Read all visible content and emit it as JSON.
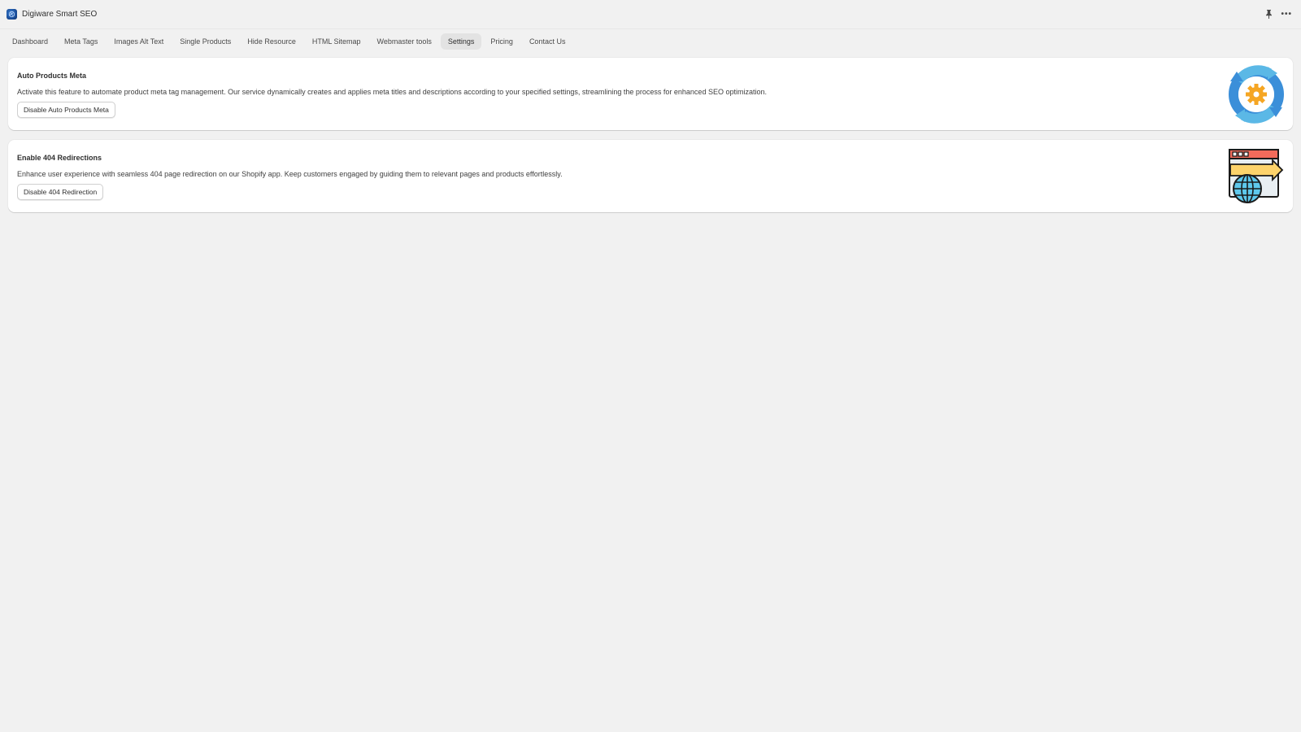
{
  "app": {
    "title": "Digiware Smart SEO",
    "logo_icon": "globe-logo-icon",
    "actions": [
      {
        "name": "pin",
        "icon": "pin-icon"
      },
      {
        "name": "more",
        "icon": "more-icon",
        "label": "•••"
      }
    ]
  },
  "nav": {
    "items": [
      {
        "label": "Dashboard",
        "active": false
      },
      {
        "label": "Meta Tags",
        "active": false
      },
      {
        "label": "Images Alt Text",
        "active": false
      },
      {
        "label": "Single Products",
        "active": false
      },
      {
        "label": "Hide Resource",
        "active": false
      },
      {
        "label": "HTML Sitemap",
        "active": false
      },
      {
        "label": "Webmaster tools",
        "active": false
      },
      {
        "label": "Settings",
        "active": true
      },
      {
        "label": "Pricing",
        "active": false
      },
      {
        "label": "Contact Us",
        "active": false
      }
    ]
  },
  "cards": [
    {
      "title": "Auto Products Meta",
      "description": "Activate this feature to automate product meta tag management. Our service dynamically creates and applies meta titles and descriptions according to your specified settings, streamlining the process for enhanced SEO optimization.",
      "button_label": "Disable Auto Products Meta",
      "image_icon": "sync-gear-icon"
    },
    {
      "title": "Enable 404 Redirections",
      "description": "Enhance user experience with seamless 404 page redirection on our Shopify app. Keep customers engaged by guiding them to relevant pages and products effortlessly.",
      "button_label": "Disable 404 Redirection",
      "image_icon": "browser-redirect-globe-icon"
    }
  ],
  "colors": {
    "background": "#f1f1f1",
    "card": "#ffffff",
    "active_tab": "#e3e3e3",
    "gear": "#f5a623",
    "sync_blue": "#3b8fd9",
    "sync_light_blue": "#5bb8e6",
    "browser_header": "#f26b5b",
    "arrow_yellow": "#fdd36b",
    "globe": "#5ec8ec"
  }
}
